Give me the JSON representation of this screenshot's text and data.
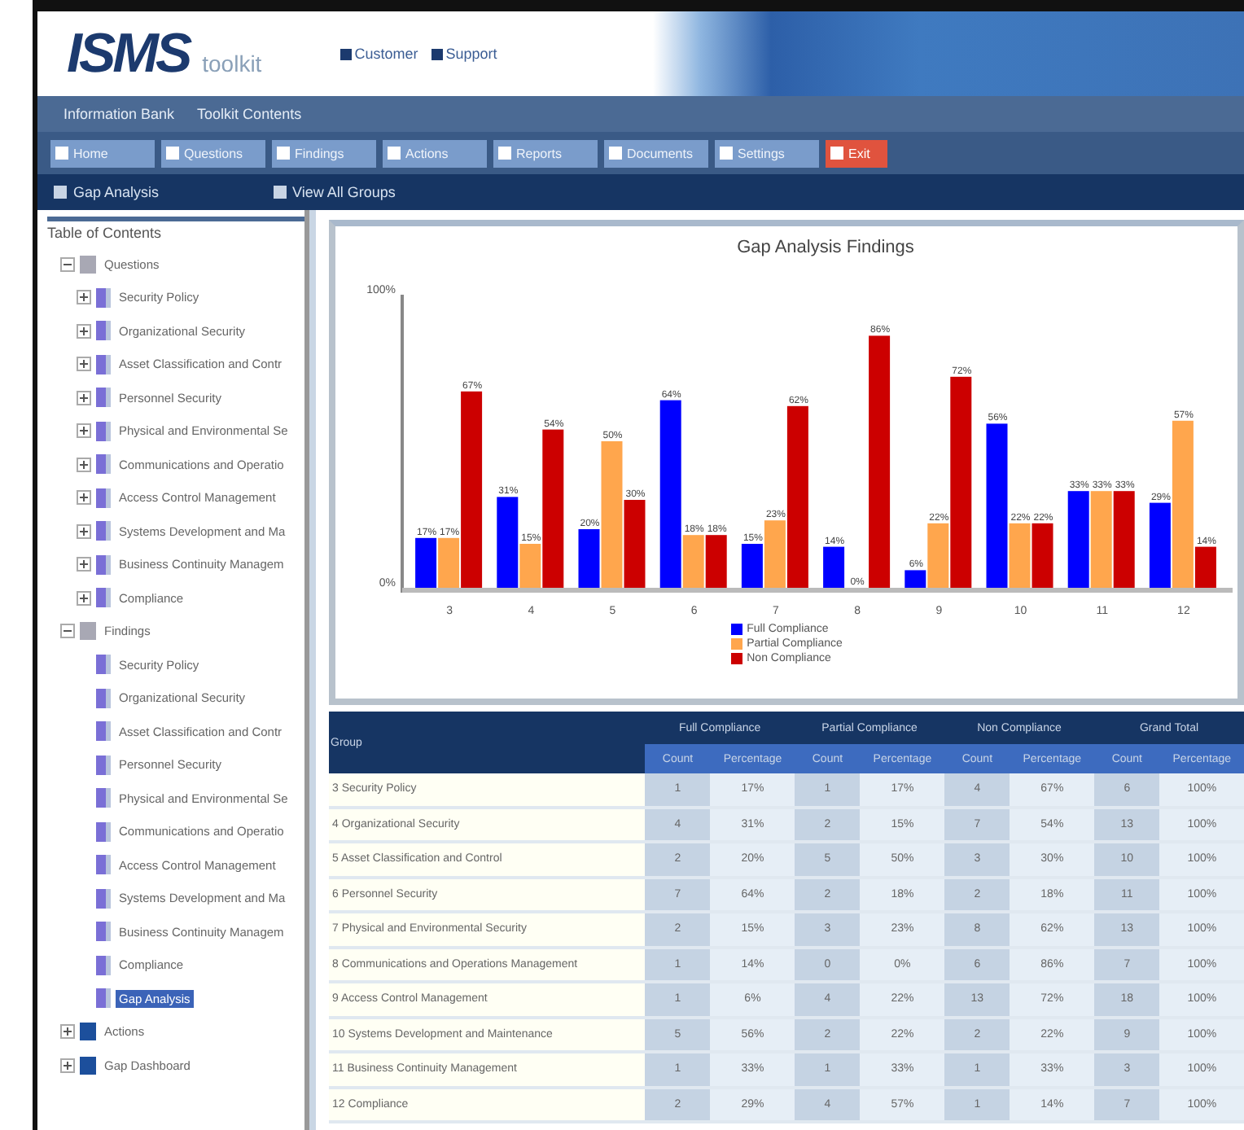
{
  "header": {
    "logo": "ISMS",
    "logo_suffix": "toolkit",
    "links": [
      "Customer",
      "Support"
    ]
  },
  "menu": [
    "Information Bank",
    "Toolkit Contents"
  ],
  "toolbar": [
    {
      "label": "Home",
      "kind": "normal"
    },
    {
      "label": "Questions",
      "kind": "normal"
    },
    {
      "label": "Findings",
      "kind": "normal"
    },
    {
      "label": "Actions",
      "kind": "normal"
    },
    {
      "label": "Reports",
      "kind": "normal"
    },
    {
      "label": "Documents",
      "kind": "normal"
    },
    {
      "label": "Settings",
      "kind": "normal"
    },
    {
      "label": "Exit",
      "kind": "exit"
    }
  ],
  "nav": [
    "Gap Analysis",
    "View All Groups"
  ],
  "tree": {
    "title": "Table of Contents",
    "items": [
      {
        "label": "Questions",
        "kind": "folder",
        "expanded": true,
        "children": [
          {
            "label": "Security Policy",
            "expanded": false,
            "selected": false
          },
          {
            "label": "Organizational Security",
            "expanded": false,
            "selected": false
          },
          {
            "label": "Asset Classification and Contr",
            "expanded": false,
            "selected": false
          },
          {
            "label": "Personnel Security",
            "expanded": false,
            "selected": false
          },
          {
            "label": "Physical and Environmental Se",
            "expanded": false,
            "selected": false
          },
          {
            "label": "Communications and Operatio",
            "expanded": false,
            "selected": false
          },
          {
            "label": "Access Control Management",
            "expanded": false,
            "selected": false
          },
          {
            "label": "Systems Development and Ma",
            "expanded": false,
            "selected": false
          },
          {
            "label": "Business Continuity Managem",
            "expanded": false,
            "selected": false
          },
          {
            "label": "Compliance",
            "expanded": false,
            "selected": false
          }
        ]
      },
      {
        "label": "Findings",
        "kind": "folder",
        "expanded": true,
        "children": [
          {
            "label": "Security Policy",
            "selected": false
          },
          {
            "label": "Organizational Security",
            "selected": false
          },
          {
            "label": "Asset Classification and Contr",
            "selected": false
          },
          {
            "label": "Personnel Security",
            "selected": false
          },
          {
            "label": "Physical and Environmental Se",
            "selected": false
          },
          {
            "label": "Communications and Operatio",
            "selected": false
          },
          {
            "label": "Access Control Management",
            "selected": false
          },
          {
            "label": "Systems Development and Ma",
            "selected": false
          },
          {
            "label": "Business Continuity Managem",
            "selected": false
          },
          {
            "label": "Compliance",
            "selected": false
          },
          {
            "label": "Gap Analysis",
            "selected": true
          }
        ]
      },
      {
        "label": "Actions",
        "kind": "module",
        "expanded": false
      },
      {
        "label": "Gap Dashboard",
        "kind": "module",
        "expanded": false
      }
    ]
  },
  "chart": {
    "chart_data": {
      "type": "bar",
      "title": "Gap Analysis Findings",
      "categories": [
        "3",
        "4",
        "5",
        "6",
        "7",
        "8",
        "9",
        "10",
        "11",
        "12"
      ],
      "series": [
        {
          "name": "Full Compliance",
          "color": "#0000ff",
          "values": [
            17,
            31,
            20,
            64,
            15,
            14,
            6,
            56,
            33,
            29
          ],
          "value_labels": [
            "17%",
            "31%",
            "20%",
            "64%",
            "15%",
            "14%",
            "6%",
            "56%",
            "33%",
            "29%"
          ]
        },
        {
          "name": "Partial Compliance",
          "color": "#ffa64d",
          "values": [
            17,
            15,
            50,
            18,
            23,
            0,
            22,
            22,
            33,
            57
          ],
          "value_labels": [
            "17%",
            "15%",
            "50%",
            "18%",
            "23%",
            "0%",
            "22%",
            "22%",
            "33%",
            "57%"
          ]
        },
        {
          "name": "Non Compliance",
          "color": "#cc0000",
          "values": [
            67,
            54,
            30,
            18,
            62,
            86,
            72,
            22,
            33,
            14
          ],
          "value_labels": [
            "67%",
            "54%",
            "30%",
            "18%",
            "62%",
            "86%",
            "72%",
            "22%",
            "33%",
            "14%"
          ]
        }
      ],
      "ylim": [
        0,
        100
      ],
      "yticks": [
        {
          "value": 0,
          "label": "0%"
        },
        {
          "value": 100,
          "label": "100%"
        }
      ],
      "data_labels": true
    }
  },
  "table": {
    "name_header": "Group",
    "groups": [
      "Full Compliance",
      "Partial Compliance",
      "Non Compliance",
      "Grand Total"
    ],
    "sub_headers": [
      "Count",
      "Percentage",
      "Count",
      "Percentage",
      "Count",
      "Percentage",
      "Count",
      "Percentage"
    ],
    "rows": [
      {
        "name": "3 Security Policy",
        "cells": [
          "1",
          "17%",
          "1",
          "17%",
          "4",
          "67%",
          "6",
          "100%"
        ]
      },
      {
        "name": "4 Organizational Security",
        "cells": [
          "4",
          "31%",
          "2",
          "15%",
          "7",
          "54%",
          "13",
          "100%"
        ]
      },
      {
        "name": "5 Asset Classification and Control",
        "cells": [
          "2",
          "20%",
          "5",
          "50%",
          "3",
          "30%",
          "10",
          "100%"
        ]
      },
      {
        "name": "6 Personnel Security",
        "cells": [
          "7",
          "64%",
          "2",
          "18%",
          "2",
          "18%",
          "11",
          "100%"
        ]
      },
      {
        "name": "7 Physical and Environmental Security",
        "cells": [
          "2",
          "15%",
          "3",
          "23%",
          "8",
          "62%",
          "13",
          "100%"
        ]
      },
      {
        "name": "8 Communications and Operations Management",
        "cells": [
          "1",
          "14%",
          "0",
          "0%",
          "6",
          "86%",
          "7",
          "100%"
        ]
      },
      {
        "name": "9 Access Control Management",
        "cells": [
          "1",
          "6%",
          "4",
          "22%",
          "13",
          "72%",
          "18",
          "100%"
        ]
      },
      {
        "name": "10 Systems Development and Maintenance",
        "cells": [
          "5",
          "56%",
          "2",
          "22%",
          "2",
          "22%",
          "9",
          "100%"
        ]
      },
      {
        "name": "11 Business Continuity Management",
        "cells": [
          "1",
          "33%",
          "1",
          "33%",
          "1",
          "33%",
          "3",
          "100%"
        ]
      },
      {
        "name": "12 Compliance",
        "cells": [
          "2",
          "29%",
          "4",
          "57%",
          "1",
          "14%",
          "7",
          "100%"
        ]
      }
    ]
  }
}
